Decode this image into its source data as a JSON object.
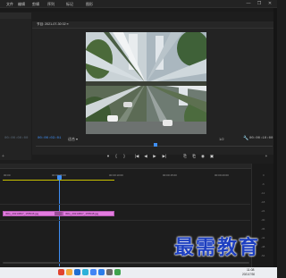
{
  "menubar": {
    "items": [
      "文件",
      "编辑",
      "剪辑",
      "序列",
      "标记",
      "图形",
      "视图",
      "窗口",
      "帮助"
    ],
    "controls": [
      "—",
      "❐",
      "✕"
    ]
  },
  "program_monitor": {
    "tab_label": "节目: 2021-07-30 02 ≡",
    "timecode_current": "00:00:03:01",
    "fit_label": "适合",
    "fit_arrow": "▾",
    "fraction": "1/2",
    "timecode_duration": "00:00:10:00"
  },
  "source_monitor": {
    "timecode": "00:00:00:00"
  },
  "transport": [
    "▾",
    "{",
    "}",
    "|◀",
    "◀",
    "▶",
    "▶|",
    "⎘",
    "⎗",
    "◉",
    "▣",
    "+"
  ],
  "timeline": {
    "ruler_labels": [
      "00:00",
      "00:00:05:00",
      "00:00:10:00",
      "00:00:15:00",
      "00:00:20:00"
    ],
    "clips": [
      "IMG_20210807_155546.jpg",
      "IMG_20210807_155548.jpg"
    ],
    "meter_marks": [
      "0",
      "-6",
      "-12",
      "-18",
      "-24",
      "-30",
      "-36",
      "-42",
      "-48",
      "-54"
    ]
  },
  "taskbar": {
    "time": "11:08",
    "date": "2021/7/30",
    "icon_colors": [
      "#e0432f",
      "#f2a93b",
      "#1f6fd1",
      "#2cb1d9",
      "#4285f4",
      "#2b7de9",
      "#6a6a6a",
      "#3fa34d",
      "#0a5fc2",
      "#888888"
    ]
  },
  "watermark": {
    "text": "最需教育"
  }
}
